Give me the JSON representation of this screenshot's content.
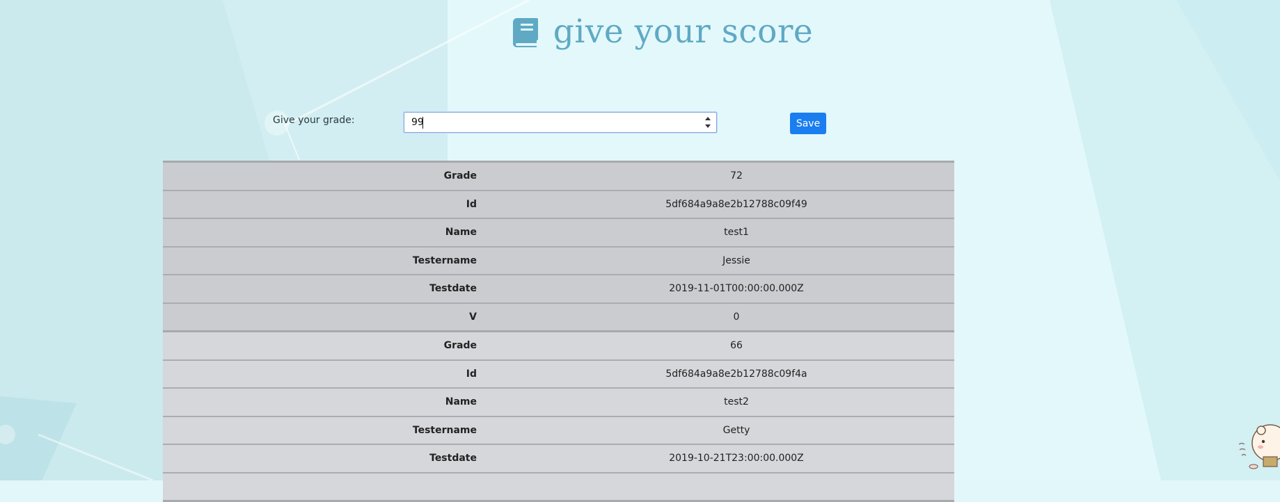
{
  "header": {
    "title": "give your score",
    "icon": "book-icon"
  },
  "form": {
    "label": "Give your grade:",
    "grade_value": "99",
    "save_label": "Save"
  },
  "colors": {
    "accent": "#5fa9c4",
    "button": "#1a7ef0"
  },
  "records": [
    {
      "rows": [
        {
          "key": "Grade",
          "value": "72"
        },
        {
          "key": "Id",
          "value": "5df684a9a8e2b12788c09f49"
        },
        {
          "key": "Name",
          "value": "test1"
        },
        {
          "key": "Testername",
          "value": "Jessie"
        },
        {
          "key": "Testdate",
          "value": "2019-11-01T00:00:00.000Z"
        },
        {
          "key": "V",
          "value": "0"
        }
      ]
    },
    {
      "rows": [
        {
          "key": "Grade",
          "value": "66"
        },
        {
          "key": "Id",
          "value": "5df684a9a8e2b12788c09f4a"
        },
        {
          "key": "Name",
          "value": "test2"
        },
        {
          "key": "Testername",
          "value": "Getty"
        },
        {
          "key": "Testdate",
          "value": "2019-10-21T23:00:00.000Z"
        }
      ]
    }
  ]
}
